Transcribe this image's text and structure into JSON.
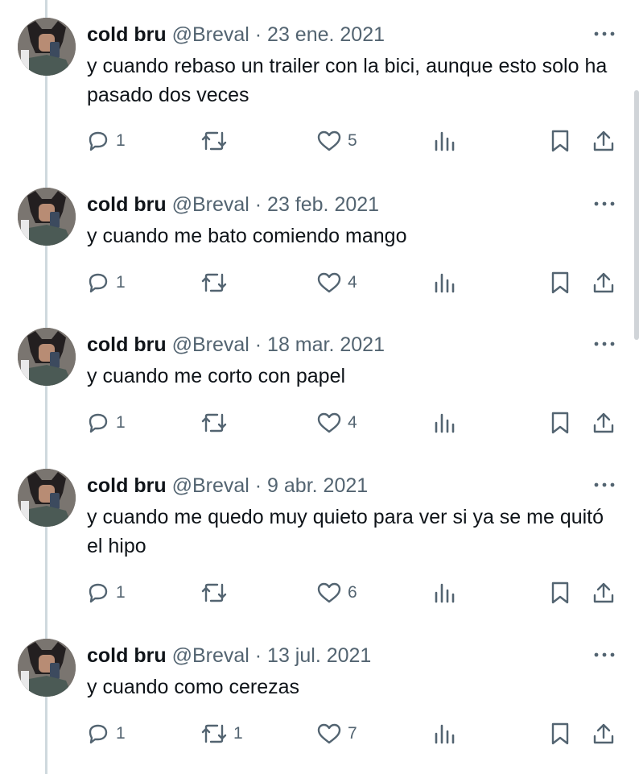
{
  "tweets": [
    {
      "name": "cold bru",
      "handle": "@Breval",
      "sep": "·",
      "date": "23 ene. 2021",
      "text": "y cuando rebaso un trailer con la bici, aunque esto solo ha pasado dos veces",
      "replies": "1",
      "retweets": "",
      "likes": "5"
    },
    {
      "name": "cold bru",
      "handle": "@Breval",
      "sep": "·",
      "date": "23 feb. 2021",
      "text": "y cuando me bato comiendo mango",
      "replies": "1",
      "retweets": "",
      "likes": "4"
    },
    {
      "name": "cold bru",
      "handle": "@Breval",
      "sep": "·",
      "date": "18 mar. 2021",
      "text": "y cuando me corto con papel",
      "replies": "1",
      "retweets": "",
      "likes": "4"
    },
    {
      "name": "cold bru",
      "handle": "@Breval",
      "sep": "·",
      "date": "9 abr. 2021",
      "text": "y cuando me quedo muy quieto para ver si ya se me quitó el hipo",
      "replies": "1",
      "retweets": "",
      "likes": "6"
    },
    {
      "name": "cold bru",
      "handle": "@Breval",
      "sep": "·",
      "date": "13 jul. 2021",
      "text": "y cuando como cerezas",
      "replies": "1",
      "retweets": "1",
      "likes": "7"
    }
  ],
  "icons": {
    "more": "more-horizontal-icon",
    "reply": "reply-bubble-icon",
    "retweet": "retweet-icon",
    "like": "heart-icon",
    "views": "views-bar-chart-icon",
    "bookmark": "bookmark-icon",
    "share": "share-upload-icon"
  },
  "colors": {
    "text": "#0f1419",
    "muted": "#536471",
    "thread_line": "#cfd9de",
    "background": "#ffffff"
  }
}
